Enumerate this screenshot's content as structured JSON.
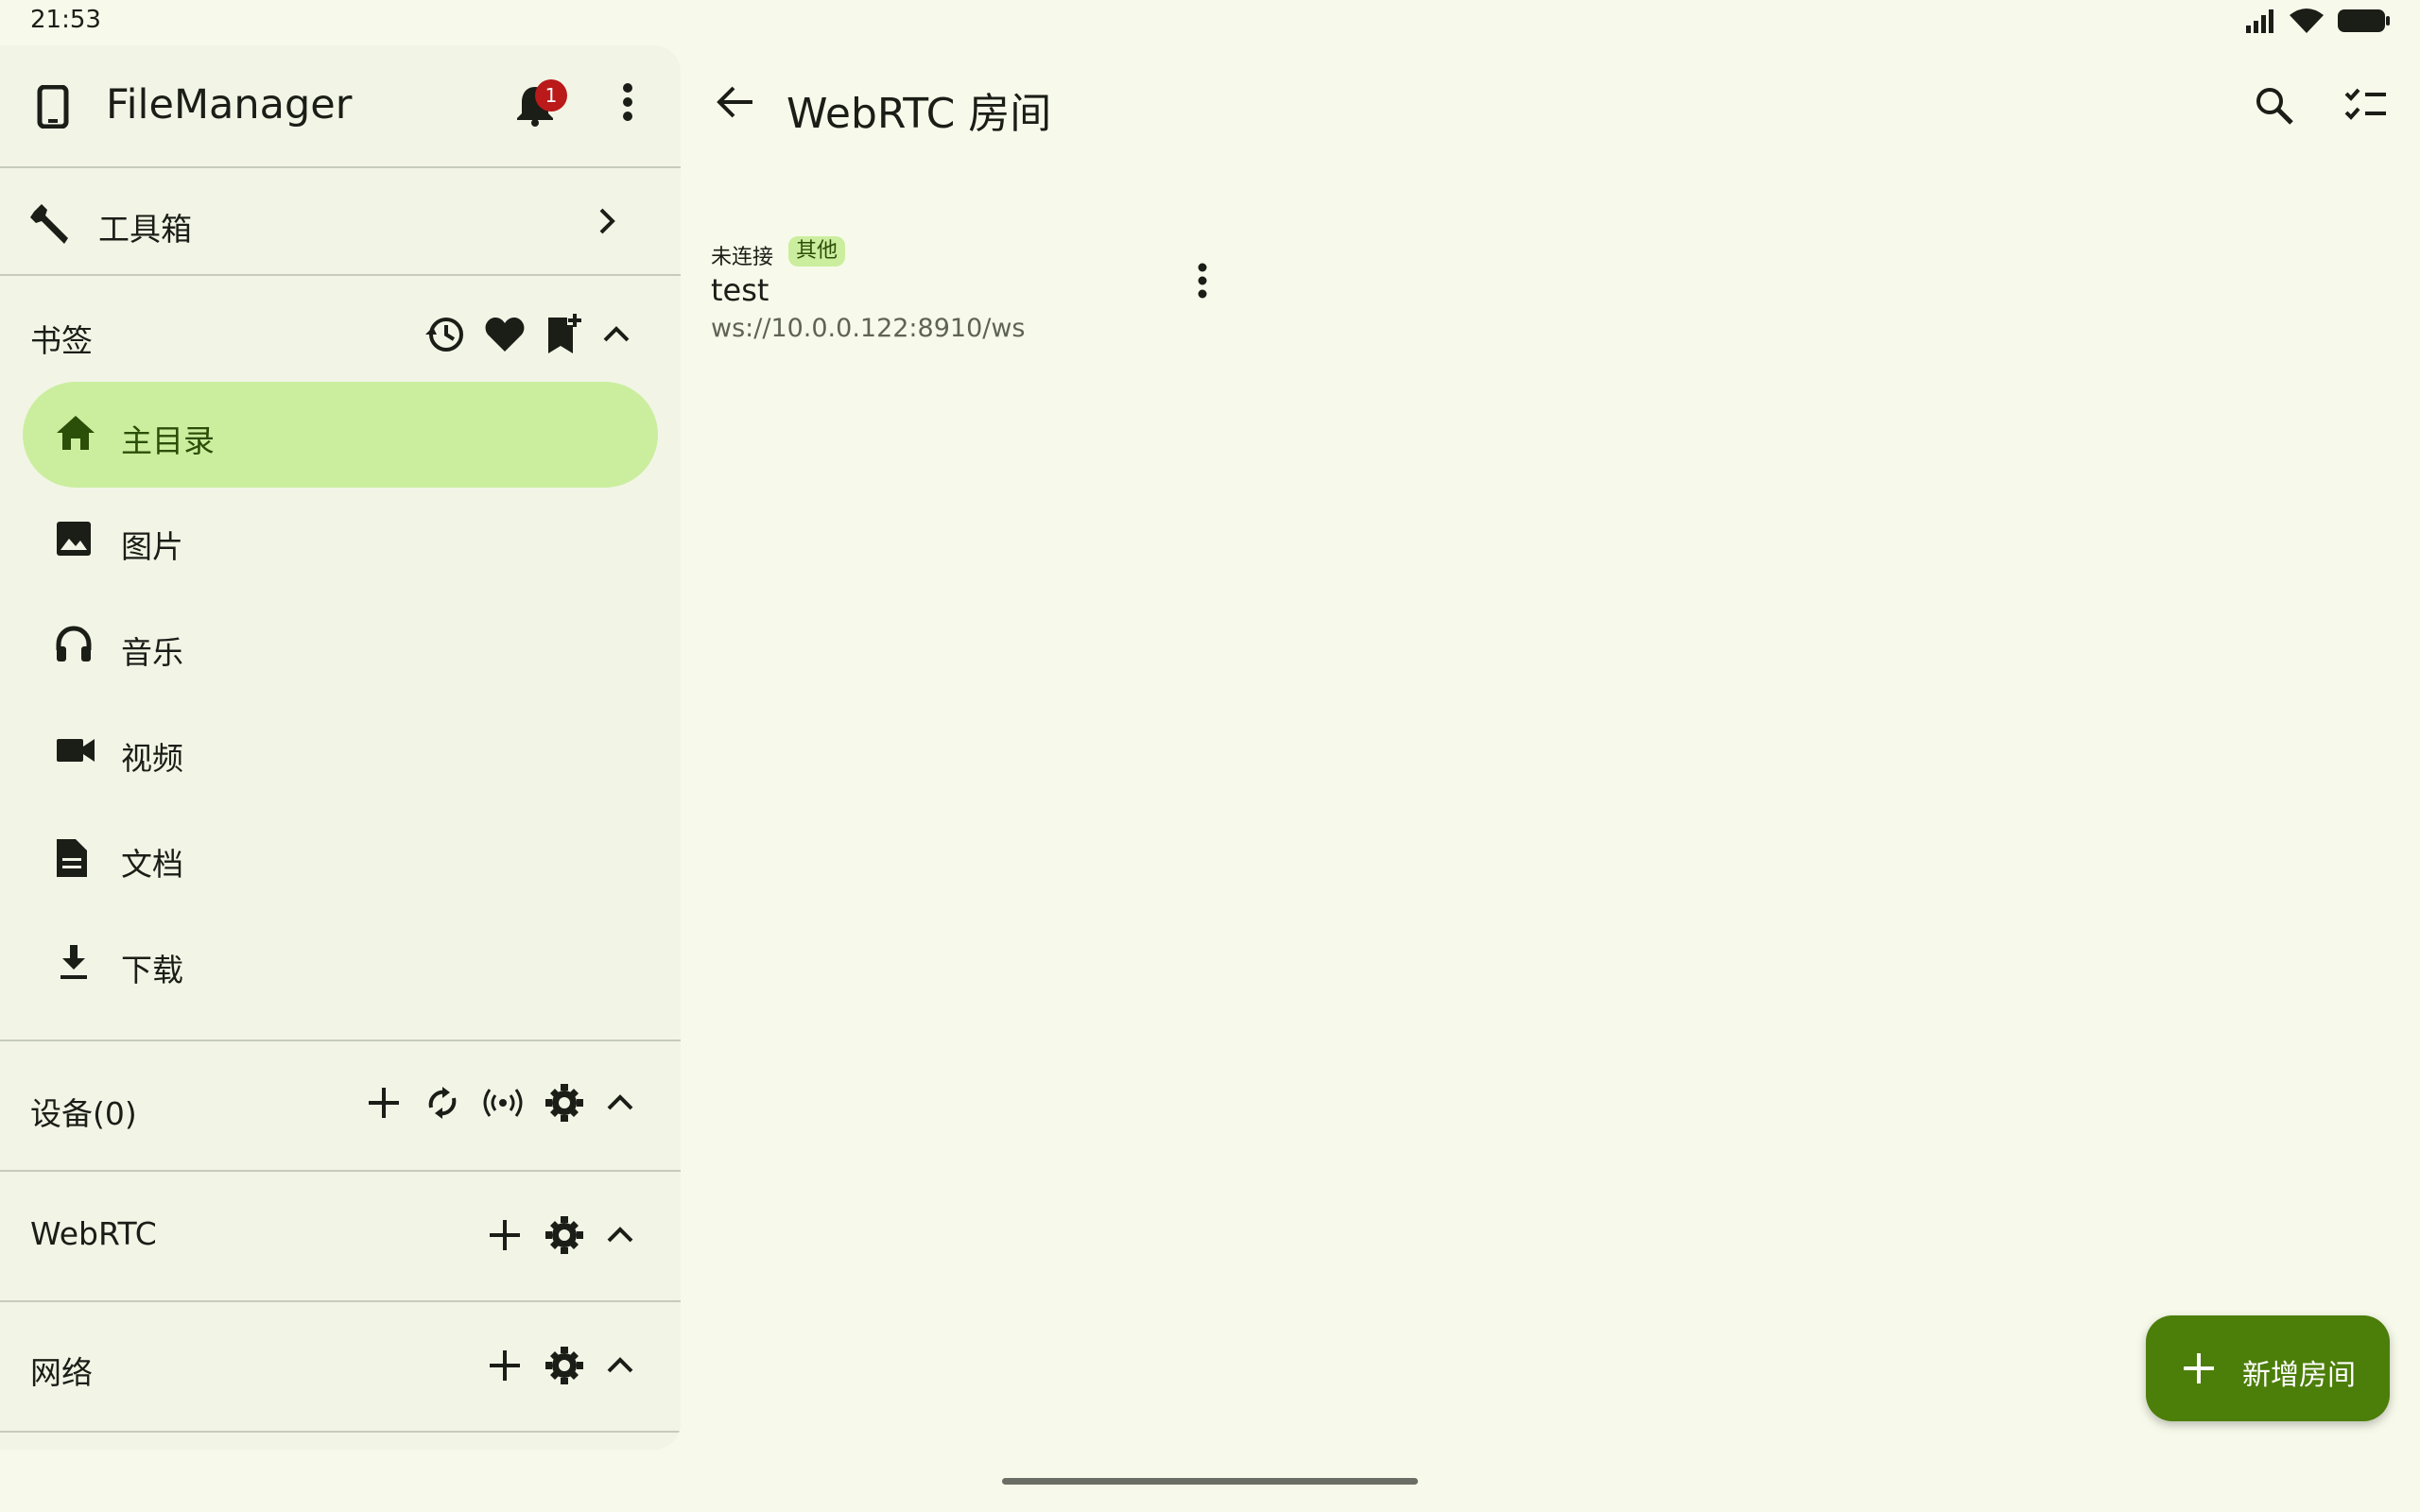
{
  "status_bar": {
    "time": "21:53",
    "icons": [
      "signal-icon",
      "wifi-icon",
      "battery-icon"
    ]
  },
  "drawer": {
    "app_title": "FileManager",
    "notification_count": "1",
    "toolbox_label": "工具箱",
    "bookmarks": {
      "title": "书签",
      "actions": [
        "history-icon",
        "heart-icon",
        "bookmark-add-icon",
        "chevron-up-icon"
      ],
      "items": [
        {
          "label": "主目录",
          "icon": "home-icon",
          "active": true
        },
        {
          "label": "图片",
          "icon": "image-icon",
          "active": false
        },
        {
          "label": "音乐",
          "icon": "headphones-icon",
          "active": false
        },
        {
          "label": "视频",
          "icon": "videocam-icon",
          "active": false
        },
        {
          "label": "文档",
          "icon": "document-icon",
          "active": false
        },
        {
          "label": "下载",
          "icon": "download-icon",
          "active": false
        }
      ]
    },
    "devices": {
      "title": "设备(0)"
    },
    "webrtc": {
      "title": "WebRTC"
    },
    "network": {
      "title": "网络"
    }
  },
  "main": {
    "title": "WebRTC 房间",
    "rooms": [
      {
        "status": "未连接",
        "tag": "其他",
        "name": "test",
        "url": "ws://10.0.0.122:8910/ws"
      }
    ],
    "fab_label": "新增房间"
  },
  "colors": {
    "background": "#f7faea",
    "drawer": "#f2f5e6",
    "active_pill": "#cbee9e",
    "fab": "#4c7e0a",
    "badge": "#ba1a1a"
  }
}
